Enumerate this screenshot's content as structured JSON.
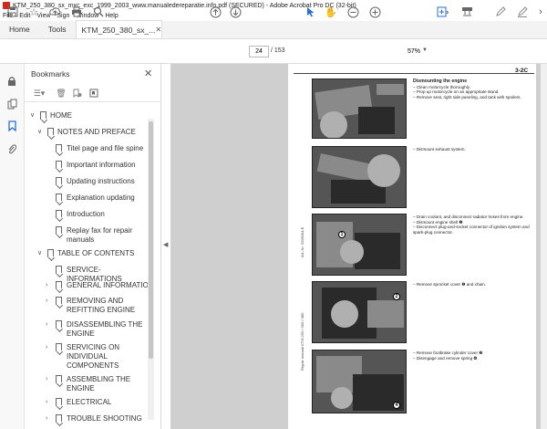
{
  "window": {
    "title": "KTM_250_380_sx_mxc_exc_1999_2003_www.manualedereparatie.info.pdf (SECURED) - Adobe Acrobat Pro DC (32-bit)"
  },
  "menu": [
    "File",
    "Edit",
    "View",
    "Sign",
    "Window",
    "Help"
  ],
  "tabs": [
    {
      "label": "Home"
    },
    {
      "label": "Tools"
    },
    {
      "label": "KTM_250_380_sx_..."
    }
  ],
  "toolbar": {
    "current_page": "24",
    "total_pages": "/ 153",
    "zoom": "57%"
  },
  "bookmarks": {
    "title": "Bookmarks",
    "items": [
      {
        "label": "HOME",
        "level": 0,
        "expanded": true
      },
      {
        "label": "NOTES AND PREFACE",
        "level": 1,
        "expanded": true
      },
      {
        "label": "Titel page and file spine",
        "level": 2
      },
      {
        "label": "Important information",
        "level": 2
      },
      {
        "label": "Updating instructions",
        "level": 2
      },
      {
        "label": "Explanation updating",
        "level": 2
      },
      {
        "label": "Introduction",
        "level": 2
      },
      {
        "label": "Replay fax for repair manuals",
        "level": 2
      },
      {
        "label": "TABLE OF CONTENTS",
        "level": 1,
        "expanded": true
      },
      {
        "label": "SERVICE-INFORMATIONS",
        "level": 2
      },
      {
        "label": "GENERAL INFORMATION",
        "level": 2,
        "collapsed": true
      },
      {
        "label": "REMOVING AND REFITTING ENGINE",
        "level": 2,
        "collapsed": true
      },
      {
        "label": "DISASSEMBLING THE ENGINE",
        "level": 2,
        "collapsed": true
      },
      {
        "label": "SERVICING ON INDIVIDUAL COMPONENTS",
        "level": 2,
        "collapsed": true
      },
      {
        "label": "ASSEMBLING THE ENGINE",
        "level": 2,
        "collapsed": true
      },
      {
        "label": "ELECTRICAL",
        "level": 2,
        "collapsed": true
      },
      {
        "label": "TROUBLE SHOOTING",
        "level": 2,
        "collapsed": true
      }
    ]
  },
  "document": {
    "page_label": "3-2C",
    "sections": [
      {
        "heading": "Dismounting the engine",
        "lines": [
          "– Clean motorcycle thoroughly.",
          "– Prop up motorcycle on an appropriate stand.",
          "– Remove seat, right side paneling, and tank with spoilers."
        ]
      },
      {
        "heading": "",
        "lines": [
          "– Dismount exhaust system."
        ]
      },
      {
        "heading": "",
        "lines": [
          "– Drain coolant, and disconnect radiator hoses from engine.",
          "– Dismount engine shell ❶.",
          "– Disconnect plug-and-socket connector of ignition system and spark-plug connector."
        ]
      },
      {
        "heading": "",
        "lines": [
          "– Remove sprocket cover ❷ and chain."
        ]
      },
      {
        "heading": "",
        "lines": [
          "– Remove footbrake cylinder cover ❸.",
          "– Disengage and remove spring ❹."
        ]
      }
    ],
    "callouts": [
      "1",
      "2",
      "4"
    ],
    "side_text_1": "Art.-Nr. 3206004-E",
    "side_text_2": "Repair manual KTM 250 / 300 / 380"
  }
}
